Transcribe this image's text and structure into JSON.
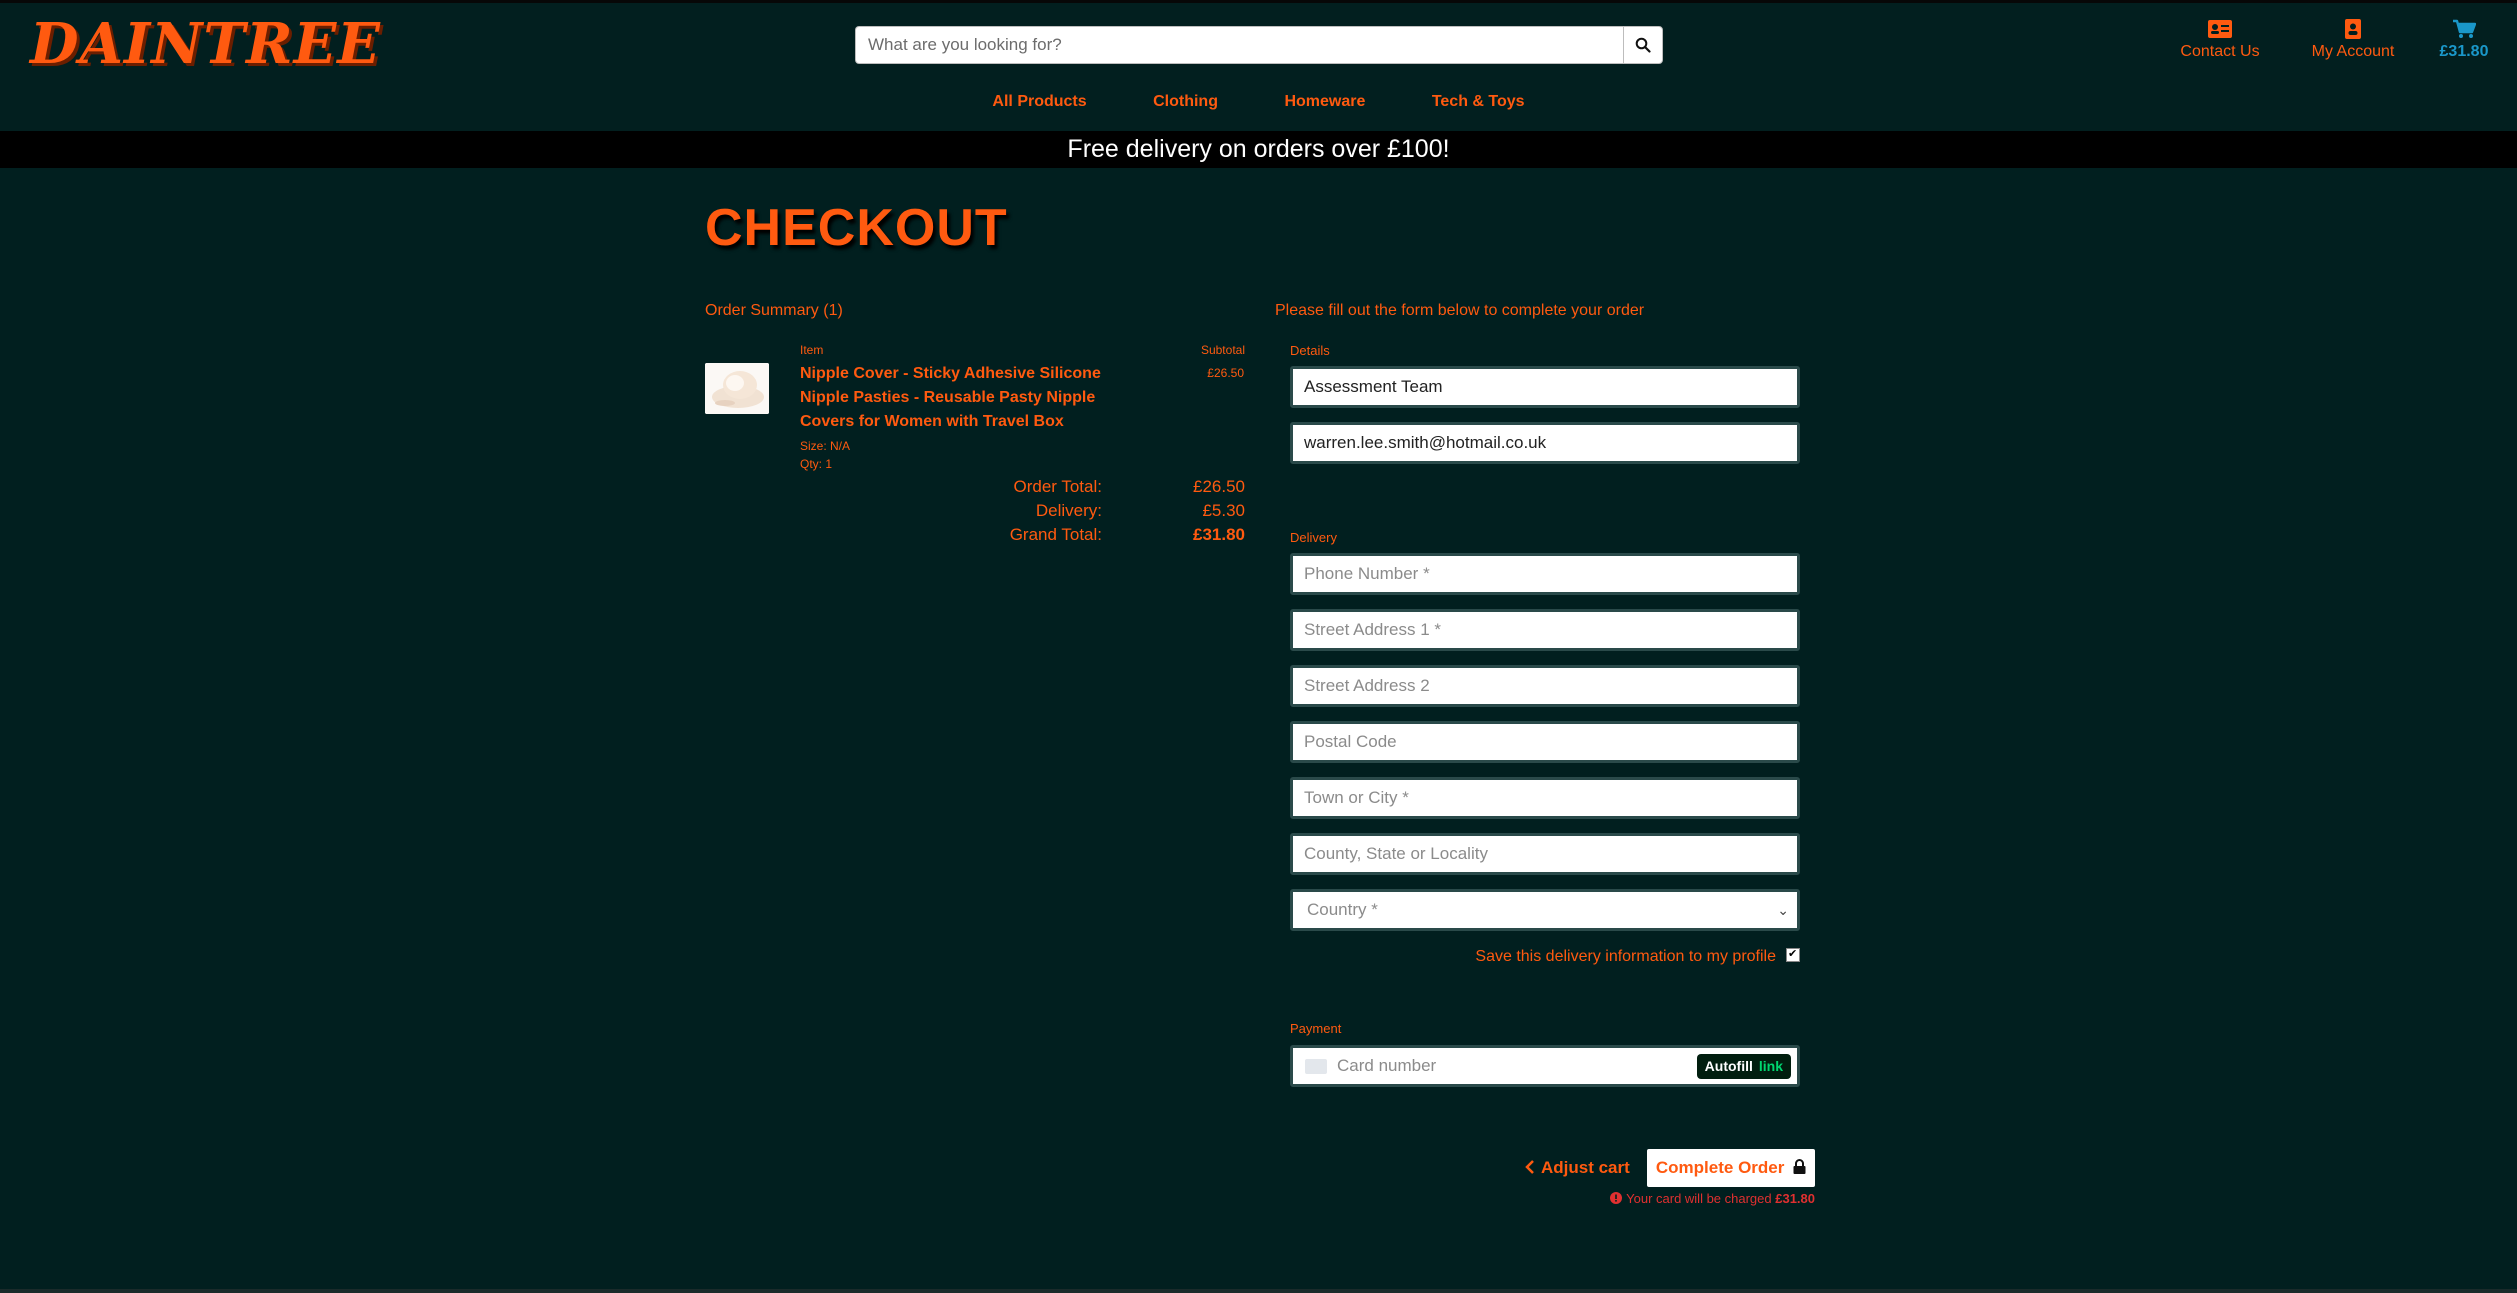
{
  "brand": {
    "logo": "DAINTREE"
  },
  "search": {
    "placeholder": "What are you looking for?"
  },
  "header": {
    "contact_label": "Contact Us",
    "account_label": "My Account",
    "cart_total": "£31.80"
  },
  "nav": {
    "items": [
      "All Products",
      "Clothing",
      "Homeware",
      "Tech & Toys"
    ]
  },
  "promo": "Free delivery on orders over £100!",
  "page_title": "CHECKOUT",
  "summary": {
    "title": "Order Summary (1)",
    "col_item": "Item",
    "col_subtotal": "Subtotal",
    "item": {
      "name": "Nipple Cover - Sticky Adhesive Silicone Nipple Pasties - Reusable Pasty Nipple Covers for Women with Travel Box",
      "size": "Size: N/A",
      "qty": "Qty: 1",
      "subtotal": "£26.50"
    },
    "order_total_label": "Order Total:",
    "order_total": "£26.50",
    "delivery_label": "Delivery:",
    "delivery": "£5.30",
    "grand_total_label": "Grand Total:",
    "grand_total": "£31.80"
  },
  "form": {
    "intro": "Please fill out the form below to complete your order",
    "details_label": "Details",
    "full_name": "Assessment Team",
    "email": "warren.lee.smith@hotmail.co.uk",
    "delivery_label": "Delivery",
    "phone_placeholder": "Phone Number *",
    "street1_placeholder": "Street Address 1 *",
    "street2_placeholder": "Street Address 2",
    "postcode_placeholder": "Postal Code",
    "town_placeholder": "Town or City *",
    "county_placeholder": "County, State or Locality",
    "country_placeholder": "Country *",
    "save_label": "Save this delivery information to my profile",
    "payment_label": "Payment",
    "card_placeholder": "Card number",
    "autofill_label": "Autofill",
    "autofill_link": "link"
  },
  "actions": {
    "adjust_cart": "Adjust cart",
    "complete_order": "Complete Order",
    "charge_notice_prefix": "Your card will be charged ",
    "charge_amount": "£31.80"
  },
  "colors": {
    "accent": "#ff5a10",
    "background": "#011f1f",
    "cart": "#1a97c9",
    "warning": "#e03030"
  },
  "icons": [
    "search-icon",
    "contact-card-icon",
    "account-icon",
    "cart-icon",
    "chevron-left-icon",
    "lock-icon",
    "warning-icon",
    "card-icon",
    "chevron-down-icon",
    "checkmark-icon"
  ]
}
